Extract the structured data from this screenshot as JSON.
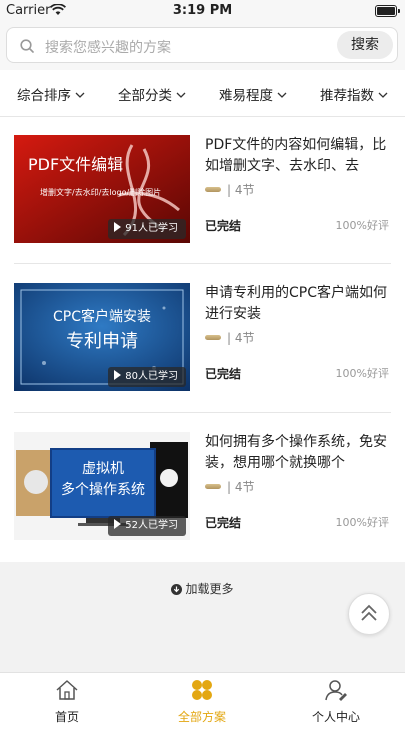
{
  "status_bar": {
    "carrier": "Carrier",
    "time": "3:19 PM"
  },
  "search": {
    "placeholder": "搜索您感兴趣的方案",
    "button": "搜索"
  },
  "filters": [
    {
      "label": "综合排序"
    },
    {
      "label": "全部分类"
    },
    {
      "label": "难易程度"
    },
    {
      "label": "推荐指数"
    }
  ],
  "courses": [
    {
      "title": "PDF文件的内容如何编辑，比如增删文字、去水印、去log…",
      "lessons": "| 4节",
      "status": "已完结",
      "rating": "100%好评",
      "learners": "91人已学习",
      "thumb_title": "PDF文件编辑",
      "thumb_subtitle": "增删文字/去水印/去logo/删除图片",
      "thumb_colors": {
        "from": "#c4120c",
        "to": "#5a0704"
      }
    },
    {
      "title": "申请专利用的CPC客户端如何进行安装",
      "lessons": "| 4节",
      "status": "已完结",
      "rating": "100%好评",
      "learners": "80人已学习",
      "thumb_title": "CPC客户端安装",
      "thumb_subtitle": "专利申请",
      "thumb_colors": {
        "from": "#1d62a8",
        "to": "#0b2f63"
      }
    },
    {
      "title": "如何拥有多个操作系统，免安装，想用哪个就换哪个",
      "lessons": "| 4节",
      "status": "已完结",
      "rating": "100%好评",
      "learners": "52人已学习",
      "thumb_title": "虚拟机",
      "thumb_subtitle": "多个操作系统",
      "thumb_colors": {
        "from": "#1e4f9e",
        "to": "#0c2350"
      }
    }
  ],
  "load_more": "加载更多",
  "tabs": [
    {
      "label": "首页",
      "icon": "home-icon"
    },
    {
      "label": "全部方案",
      "icon": "clover-icon"
    },
    {
      "label": "个人中心",
      "icon": "profile-icon"
    }
  ],
  "colors": {
    "accent": "#e3a712",
    "text": "#222222",
    "muted": "#999999",
    "background_gray": "#f2f2f2"
  }
}
